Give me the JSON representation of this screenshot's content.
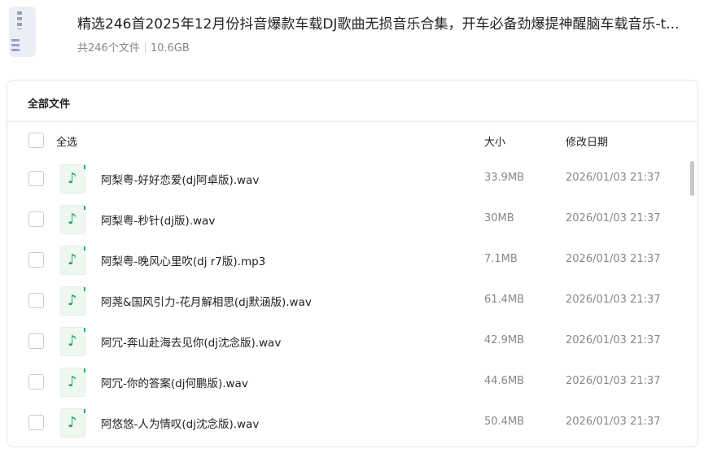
{
  "header": {
    "title": "精选246首2025年12月份抖音爆款车载DJ歌曲无损音乐合集，开车必备劲爆提神醒脑车载音乐-t...",
    "count": "共246个文件",
    "size": "10.6GB"
  },
  "card": {
    "title": "全部文件",
    "select_all": "全选",
    "col_size": "大小",
    "col_date": "修改日期"
  },
  "files": [
    {
      "name": "阿梨粤-好好恋爱(dj阿卓版).wav",
      "size": "33.9MB",
      "date": "2026/01/03 21:37"
    },
    {
      "name": "阿梨粤-秒针(dj版).wav",
      "size": "30MB",
      "date": "2026/01/03 21:37"
    },
    {
      "name": "阿梨粤-晚风心里吹(dj r7版).mp3",
      "size": "7.1MB",
      "date": "2026/01/03 21:37"
    },
    {
      "name": "阿荛&国风引力-花月解相思(dj默涵版).wav",
      "size": "61.4MB",
      "date": "2026/01/03 21:37"
    },
    {
      "name": "阿冗-奔山赴海去见你(dj沈念版).wav",
      "size": "42.9MB",
      "date": "2026/01/03 21:37"
    },
    {
      "name": "阿冗-你的答案(dj何鹏版).wav",
      "size": "44.6MB",
      "date": "2026/01/03 21:37"
    },
    {
      "name": "阿悠悠-人为情叹(dj沈念版).wav",
      "size": "50.4MB",
      "date": "2026/01/03 21:37"
    }
  ]
}
